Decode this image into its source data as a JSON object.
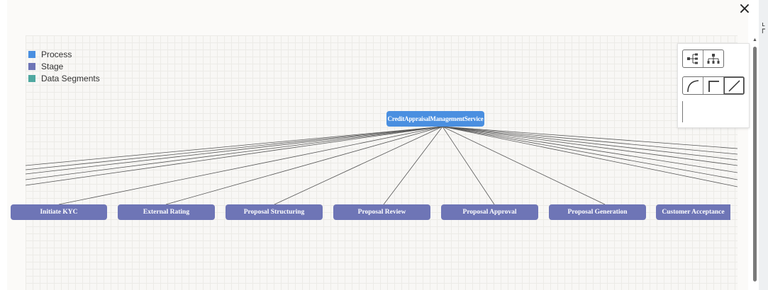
{
  "close_icon": "×",
  "legend": [
    {
      "label": "Process",
      "color": "#4a8fe0"
    },
    {
      "label": "Stage",
      "color": "#6e75b6"
    },
    {
      "label": "Data Segments",
      "color": "#4fa8a0"
    }
  ],
  "root_node": {
    "label": "CreditAppraisalManagementService",
    "color": "#4a8fe0"
  },
  "stages": [
    {
      "label": "Initiate KYC"
    },
    {
      "label": "External Rating"
    },
    {
      "label": "Proposal Structuring"
    },
    {
      "label": "Proposal Review"
    },
    {
      "label": "Proposal Approval"
    },
    {
      "label": "Proposal Generation"
    },
    {
      "label": "Customer Acceptance"
    }
  ],
  "toolbar": {
    "layout_buttons": [
      "horizontal-tree-icon",
      "vertical-tree-icon"
    ],
    "edge_buttons": [
      "curved-edge-icon",
      "elbow-edge-icon",
      "straight-edge-icon"
    ],
    "selected_edge": "straight-edge-icon"
  },
  "colors": {
    "canvas": "#f8f7f5",
    "stage": "#6e75b6",
    "process": "#4a8fe0"
  }
}
